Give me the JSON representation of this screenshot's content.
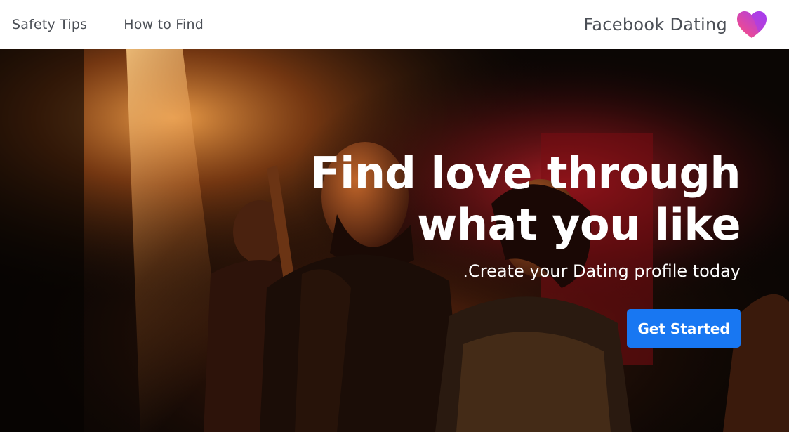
{
  "nav": {
    "links": [
      {
        "label": "Safety Tips"
      },
      {
        "label": "How to Find"
      }
    ]
  },
  "brand": {
    "name": "Facebook Dating",
    "logo_icon": "heart-icon",
    "logo_colors": [
      "#ff4f7b",
      "#a43cf0"
    ]
  },
  "hero": {
    "headline_line1": "Find love through",
    "headline_line2": "what you like",
    "subline": ".Create your Dating profile today",
    "cta_label": "Get Started"
  },
  "colors": {
    "accent": "#1877f2",
    "nav_text": "#4b4f56"
  }
}
